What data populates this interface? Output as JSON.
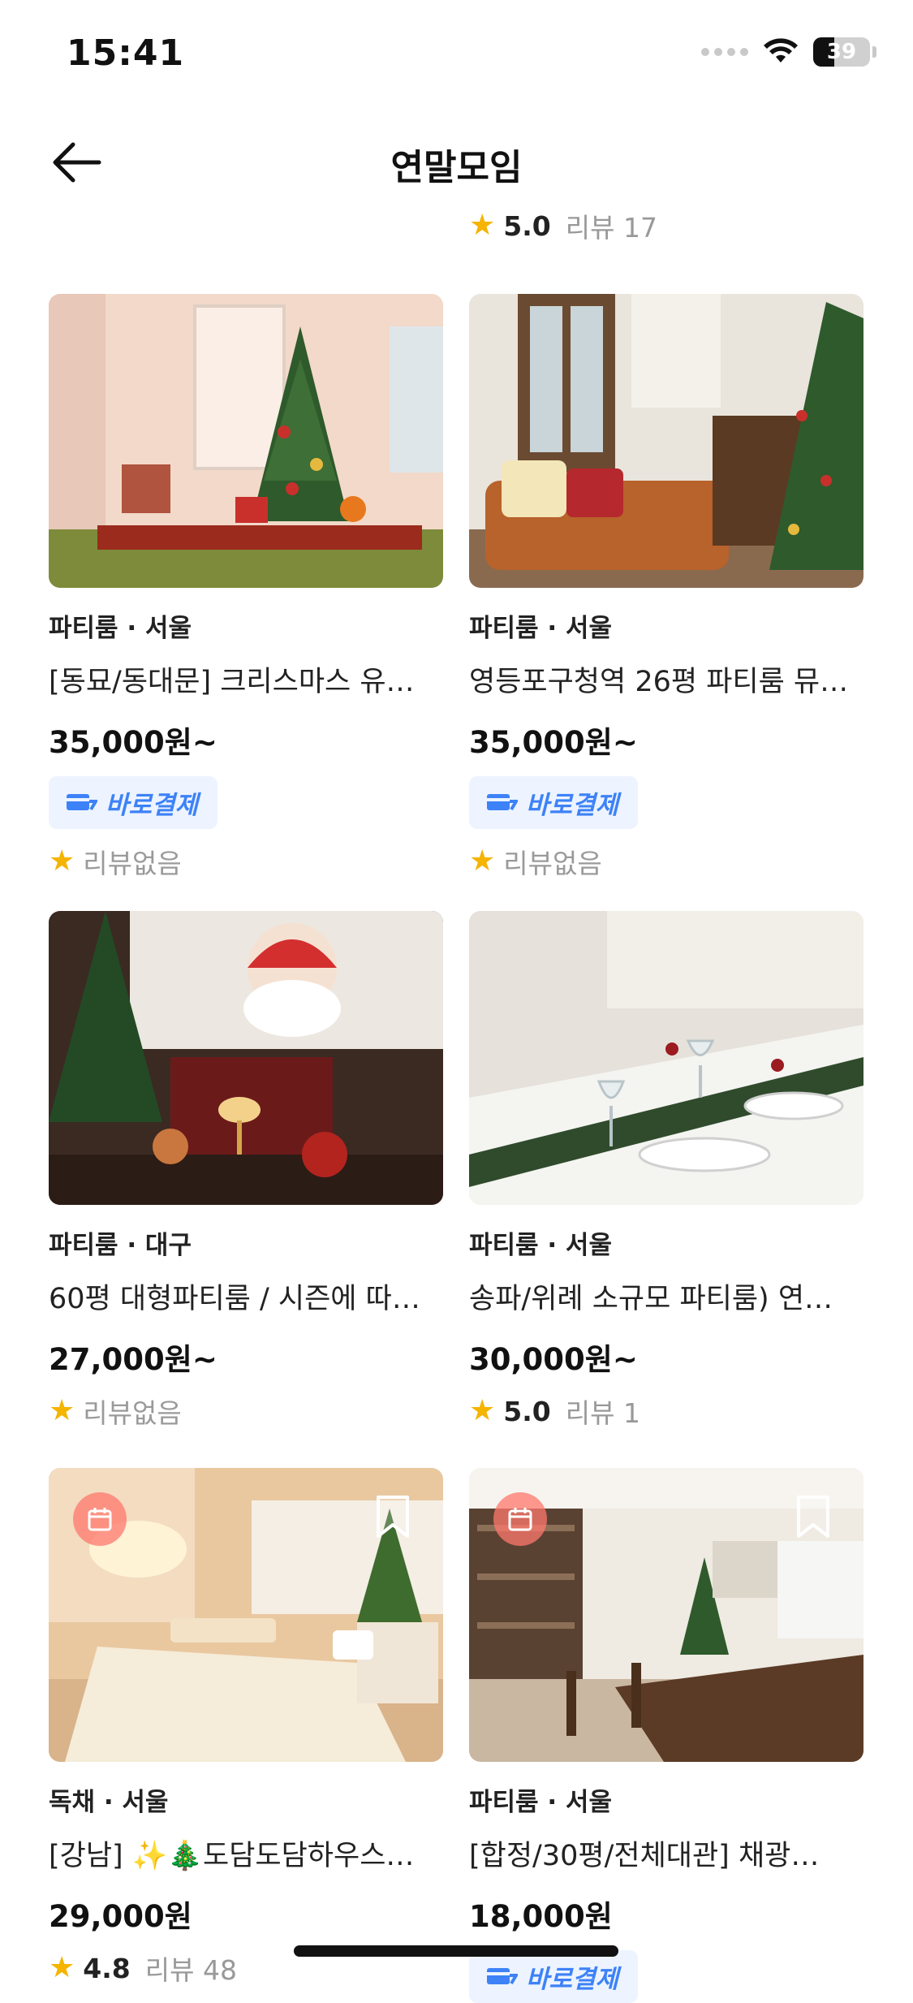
{
  "status": {
    "time": "15:41",
    "battery": "39"
  },
  "header": {
    "title": "연말모임"
  },
  "top_rating": {
    "value": "5.0",
    "reviews": "리뷰 17"
  },
  "cards": [
    {
      "category": "파티룸 · 서울",
      "title": "[동묘/동대문] 크리스마스 유…",
      "price": "35,000원~",
      "pay": "바로결제",
      "rating_text": "리뷰없음"
    },
    {
      "category": "파티룸 · 서울",
      "title": "영등포구청역 26평 파티룸 뮤…",
      "price": "35,000원~",
      "pay": "바로결제",
      "rating_text": "리뷰없음"
    },
    {
      "category": "파티룸 · 대구",
      "title": "60평 대형파티룸 / 시즌에 따…",
      "price": "27,000원~",
      "rating_text": "리뷰없음"
    },
    {
      "category": "파티룸 · 서울",
      "title": "송파/위례 소규모 파티룸) 연…",
      "price": "30,000원~",
      "rating_value": "5.0",
      "rating_reviews": "리뷰 1"
    },
    {
      "category": "독채 · 서울",
      "title": "[강남] ✨🎄도담도담하우스…",
      "price": "29,000원",
      "rating_value": "4.8",
      "rating_reviews": "리뷰 48"
    },
    {
      "category": "파티룸 · 서울",
      "title": "[합정/30평/전체대관] 채광…",
      "price": "18,000원",
      "pay": "바로결제"
    }
  ],
  "colors": {
    "accent": "#3d82f7",
    "star": "#f5b400",
    "badge_bg": "#edf4ff"
  }
}
